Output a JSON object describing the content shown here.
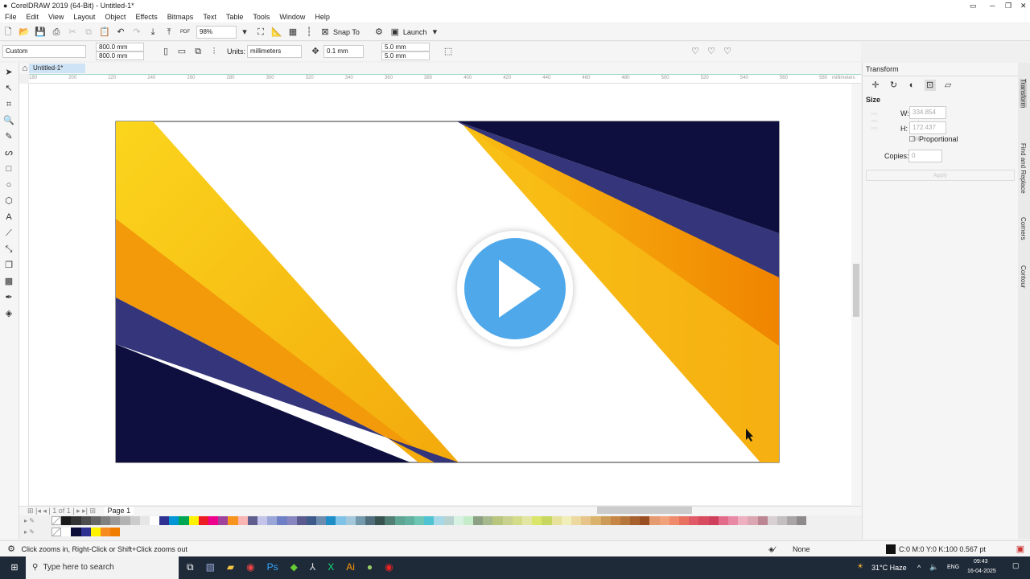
{
  "window": {
    "title": "CorelDRAW 2019 (64-Bit) - Untitled-1*"
  },
  "menu": [
    "File",
    "Edit",
    "View",
    "Layout",
    "Object",
    "Effects",
    "Bitmaps",
    "Text",
    "Table",
    "Tools",
    "Window",
    "Help"
  ],
  "toolbar": {
    "zoom": "98%",
    "snap_to": "Snap To",
    "launch": "Launch"
  },
  "property_bar": {
    "page_preset": "Custom",
    "width": "800.0 mm",
    "height": "800.0 mm",
    "units_label": "Units:",
    "units": "millimeters",
    "nudge": "0.1 mm",
    "dup_x": "5.0 mm",
    "dup_y": "5.0 mm"
  },
  "document_tab": "Untitled-1*",
  "ruler": {
    "labels": [
      "180",
      "200",
      "220",
      "240",
      "260",
      "280",
      "300",
      "320",
      "340",
      "360",
      "380",
      "400",
      "420",
      "440",
      "460",
      "480",
      "500",
      "520",
      "540",
      "560",
      "580"
    ],
    "unit": "millimeters"
  },
  "page_tab": "Page 1",
  "palette": {
    "main": [
      "#1a1a1a",
      "#333333",
      "#4d4d4d",
      "#666666",
      "#808080",
      "#999999",
      "#b3b3b3",
      "#cccccc",
      "#e6e6e6",
      "#ffffff",
      "#2e3192",
      "#0096d6",
      "#00a651",
      "#fff200",
      "#ed1c24",
      "#ec008c",
      "#a0449b",
      "#f7941d",
      "#f9b4b4",
      "#605e8f",
      "#c4c4ea",
      "#9aa6d8",
      "#6f7fc5",
      "#8886c1",
      "#5a5a8e",
      "#3d5a8a",
      "#6e8dae",
      "#1d8ec8",
      "#7fc4e8",
      "#a3c8db",
      "#7399aa",
      "#4f6d7a",
      "#38524f",
      "#517f74",
      "#5ea593",
      "#62b1a0",
      "#6dc6b4",
      "#4fc3d1",
      "#a6d8e8",
      "#b8d2d0",
      "#d7f2e2",
      "#c5ecc8",
      "#8ca183",
      "#a6b98d",
      "#b8c57d",
      "#c9d18e",
      "#d4dc8a",
      "#e3e6a2",
      "#d9e66a",
      "#c8d75f",
      "#e6e29c",
      "#f0efb9",
      "#ecd9a0",
      "#e7c58a",
      "#d9b36b",
      "#cc9b57",
      "#c88646",
      "#b5773b",
      "#a7612e",
      "#9a4f22",
      "#e69a6f",
      "#f2a27a",
      "#f08a6d",
      "#e8725f",
      "#e05a68",
      "#d84a5d",
      "#cf3f5b",
      "#e26b8a",
      "#e88aa5",
      "#eeb0c0",
      "#d9a6b2",
      "#bc8592",
      "#d8d0d2",
      "#c3bfc0",
      "#a9a5a6",
      "#8e8a8b"
    ],
    "document": [
      "#ffffff",
      "#0d0d3a",
      "#2e3192",
      "#fff200",
      "#f68b1f",
      "#f07c00"
    ]
  },
  "art": {
    "navy": "#0f0f3f",
    "purple": "#34357a",
    "orange": "#f08a00",
    "yellow": "#f9c615",
    "play_blue": "#4fa8ea"
  },
  "docker": {
    "title": "Transform",
    "section": "Size",
    "w_label": "W:",
    "w_value": "334.854 mi",
    "h_label": "H:",
    "h_value": "172.437 mi",
    "proportional": "Proportional",
    "copies_label": "Copies:",
    "copies_value": "0",
    "apply": "Apply",
    "tabs": [
      "Transform",
      "Find and Replace",
      "Corners",
      "Contour"
    ]
  },
  "status": {
    "hint": "Click zooms in, Right-Click or Shift+Click zooms out",
    "fill": "None",
    "outline": "C:0 M:0 Y:0 K:100  0.567 pt"
  },
  "taskbar": {
    "search_placeholder": "Type here to search",
    "weather": "31°C  Haze",
    "lang": "ENG",
    "time": "09:43",
    "date": "16-04-2025"
  }
}
